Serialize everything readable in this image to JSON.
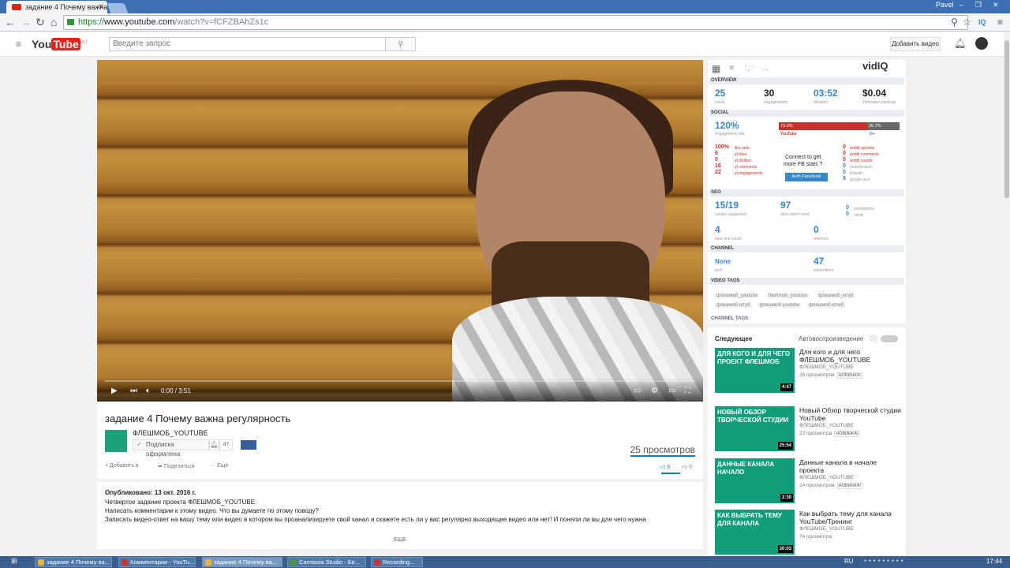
{
  "browser": {
    "tab_title": "задание 4 Почему важна р",
    "url_scheme": "https://",
    "url_host": "www.youtube.com",
    "url_path": "/watch?v=fCFZBAhZs1c",
    "user_label": "Pavel"
  },
  "youtube": {
    "logo_you": "You",
    "logo_tube": "Tube",
    "logo_region": "RU",
    "search_placeholder": "Введите запрос",
    "upload_label": "Добавить видео"
  },
  "player": {
    "time": "0:00 / 3:51",
    "progress": 0
  },
  "video": {
    "title": "задание 4 Почему важна регулярность",
    "channel": "ФЛЕШМОБ_YOUTUBE",
    "subscribe_label": "Подписка оформлена",
    "subscriber_count": "47",
    "views": "25 просмотров",
    "actions": [
      "Добавить в",
      "Поделиться",
      "Ещё"
    ],
    "likes": "6",
    "dislikes": "0"
  },
  "description": {
    "published": "Опубликовано: 13 окт. 2016 г.",
    "lines": [
      "Четвертое задание проекта ФЛЕШМОБ_YOUTUBE:",
      "Написать комментарии к этому видео. Что вы думаете по этому поводу?",
      "Записать видео-ответ на вашу тему или видео в котором вы проанализируете свой канал и скажете есть ли у вас регулярно выходящие видео или нет! И поняли ли вы для чего нужна"
    ],
    "more": "ЕЩЕ"
  },
  "vidiq": {
    "logo": "vidIQ",
    "sections": {
      "overview": "OVERVIEW",
      "social": "SOCIAL",
      "seo": "SEO",
      "channel": "CHANNEL",
      "video_tags": "VIDEO TAGS",
      "channel_tags": "CHANNEL TAGS"
    },
    "overview": [
      {
        "value": "25",
        "label": "views"
      },
      {
        "value": "30",
        "label": "engagements"
      },
      {
        "value": "03:52",
        "label": "duration"
      },
      {
        "value": "$0.04",
        "label": "estimated earnings"
      }
    ],
    "social": {
      "engagement": "120%",
      "engagement_label": "engagement rate",
      "youtube_pct": "73.3%",
      "other_pct": "26.7%",
      "youtube_label": "YouTube",
      "other_label": "G+",
      "stats": [
        {
          "value": "100%",
          "label": "like ratio"
        },
        {
          "value": "6",
          "label": "yt likes"
        },
        {
          "value": "0",
          "label": "yt dislikes"
        },
        {
          "value": "16",
          "label": "yt comments"
        },
        {
          "value": "22",
          "label": "yt engagements"
        }
      ],
      "fb_prompt_1": "Connect to get",
      "fb_prompt_2": "more FB stats ?",
      "fb_button": "Auth Facebook",
      "reddit": [
        {
          "value": "0",
          "label": "reddit upvotes"
        },
        {
          "value": "0",
          "label": "reddit comments"
        },
        {
          "value": "0",
          "label": "reddit counts"
        },
        {
          "value": "0",
          "label": "stumbleupon"
        },
        {
          "value": "0",
          "label": "linkedin"
        },
        {
          "value": "8",
          "label": "google plus"
        }
      ]
    },
    "seo": [
      {
        "value": "15/19",
        "label": "creator suggested"
      },
      {
        "value": "97",
        "label": "desc word count"
      },
      {
        "value": "0",
        "label": "annotations"
      },
      {
        "value": "0",
        "label": "cards"
      },
      {
        "value": "4",
        "label": "desc link count"
      },
      {
        "value": "0",
        "label": "referrers"
      }
    ],
    "channel": [
      {
        "value": "None",
        "label": "tech"
      },
      {
        "value": "47",
        "label": "subscribers"
      }
    ],
    "tags": [
      "флешмоб_youtube",
      "flashmob_youtube",
      "флешмоб_ютуб",
      "флешмоб ютуб",
      "флешмоб youtube",
      "флешмоб ютюб"
    ]
  },
  "upnext": {
    "heading": "Следующее",
    "autoplay": "Автовоспроизведение",
    "items": [
      {
        "thumb": "ДЛЯ КОГО И ДЛЯ ЧЕГО ПРОЕКТ ФЛЕШМОБ",
        "duration": "4:47",
        "title": "Для кого и для чего ФЛЕШМОБ_YOUTUBE",
        "channel": "ФЛЕШМОБ_YOUTUBE",
        "views": "26 просмотров",
        "badge": "НОВИНКА!"
      },
      {
        "thumb": "НОВЫЙ ОБЗОР ТВОРЧЕСКОЙ СТУДИИ",
        "duration": "25:54",
        "title": "Новый Обзор творческой студии YouTube",
        "channel": "ФЛЕШМОБ_YOUTUBE",
        "views": "23 просмотра",
        "badge": "НОВИНКА!"
      },
      {
        "thumb": "ДАННЫЕ КАНАЛА НАЧАЛО",
        "duration": "2:30",
        "title": "Данные канала в начале проекта",
        "channel": "ФЛЕШМОБ_YOUTUBE",
        "views": "14 просмотров",
        "badge": "НОВИНКА!"
      },
      {
        "thumb": "КАК ВЫБРАТЬ ТЕМУ ДЛЯ КАНАЛА",
        "duration": "30:03",
        "title": "Как выбрать тему для канала YouTube/Тренинг",
        "channel": "ФЛЕШМОБ_YOUTUBE",
        "views": "74 просмотра",
        "badge": ""
      }
    ]
  },
  "taskbar": {
    "items": [
      "задание 4 Почему ва...",
      "Комментарии - YouTu...",
      "задание 4 Почему ва...",
      "Camtasia Studio - Бе...",
      "Recording..."
    ],
    "lang": "RU",
    "clock": "17:44"
  }
}
